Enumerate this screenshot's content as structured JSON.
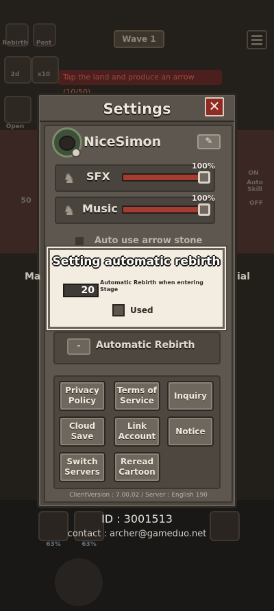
{
  "background": {
    "top_left_buttons": [
      "Rebirth",
      "Post"
    ],
    "side_labels": [
      "2d",
      "x10",
      "Open"
    ],
    "stage_button": "Wave 1",
    "quest_text": "Tap the land and produce an arrow (10/50)",
    "right_labels": [
      "ON",
      "Auto Skill",
      "OFF"
    ],
    "left_number": "50",
    "slot_percents": [
      "63%",
      "63%"
    ]
  },
  "settings": {
    "title": "Settings",
    "close_symbol": "✕",
    "profile": {
      "nickname": "NiceSimon",
      "edit_symbol": "✎"
    },
    "sfx": {
      "label": "SFX",
      "percent_label": "100%",
      "value": 1.0
    },
    "music": {
      "label": "Music",
      "percent_label": "100%",
      "value": 1.0
    },
    "auto_use_label": "Auto use arrow stone",
    "tabs": [
      "Ma",
      "ial"
    ],
    "auto_rebirth": {
      "minus_symbol": "-",
      "label": "Automatic Rebirth"
    },
    "buttons": [
      "Privacy Policy",
      "Terms of Service",
      "Inquiry",
      "Cloud Save",
      "Link Account",
      "Notice",
      "Switch Servers",
      "Reread Cartoon"
    ],
    "version_text": "ClientVersion : 7.00.02 / Server : English 190"
  },
  "popup": {
    "title": "Setting automatic rebirth",
    "stage_value": "20",
    "description": "Automatic Rebirth when entering Stage",
    "used_label": "Used",
    "used_checked": false
  },
  "footer": {
    "id_text": "ID : 3001513",
    "contact_text": "contact : archer@gameduo.net"
  },
  "colors": {
    "accent_red": "#a33c33",
    "close_red": "#8f2a24",
    "panel": "#4e4841",
    "popup_bg": "#f3ece1"
  }
}
